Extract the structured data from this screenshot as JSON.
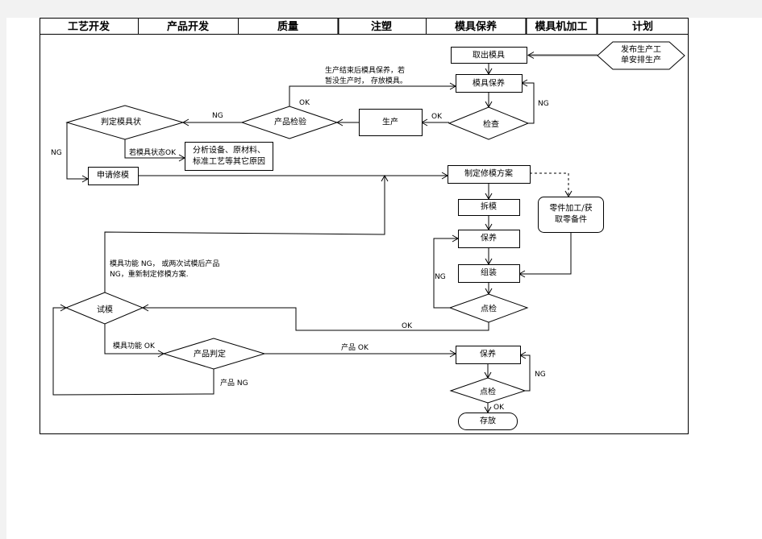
{
  "header": {
    "columns": [
      "工艺开发",
      "产品开发",
      "质量",
      "注塑",
      "模具保养",
      "模具机加工",
      "计划"
    ]
  },
  "nodes": {
    "publish_order": [
      "发布生产工",
      "单安排生产"
    ],
    "take_out_mold": "取出模具",
    "mold_maintenance": "模具保养",
    "inspect": "检查",
    "production": "生产",
    "product_inspection": "产品检验",
    "judge_mold_state": "判定模具状",
    "analyze_causes": [
      "分析设备、原材料、",
      "标准工艺等其它原因"
    ],
    "apply_repair": "申请修模",
    "make_repair_plan": "制定修模方案",
    "parts_machining": [
      "零件加工/获",
      "取零备件"
    ],
    "disassemble": "拆模",
    "maintain": "保养",
    "assemble": "组装",
    "spot_check": "点检",
    "trial_mold": "试模",
    "product_judgement": "产品判定",
    "maintain_2": "保养",
    "spot_check_2": "点检",
    "store": "存放"
  },
  "edge_labels": {
    "inspect_ng": "NG",
    "inspect_ok": "OK",
    "product_inspection_ok": "OK",
    "after_production_note": [
      "生产结束后模具保养，若",
      "暂没生产时， 存放模具。"
    ],
    "product_inspection_ng": "NG",
    "mold_state_ok": "若模具状态OK",
    "mold_state_ng": "NG",
    "spot_check_ng": "NG",
    "spot_check_ok": "OK",
    "retrial_note": [
      "模具功能 NG， 或两次试模后产品",
      "NG，重新制定修模方案."
    ],
    "mold_function_ok": "模具功能 OK",
    "product_ok": "产品 OK",
    "product_ng": "产品 NG",
    "spot_check_2_ng": "NG",
    "spot_check_2_ok": "OK"
  }
}
